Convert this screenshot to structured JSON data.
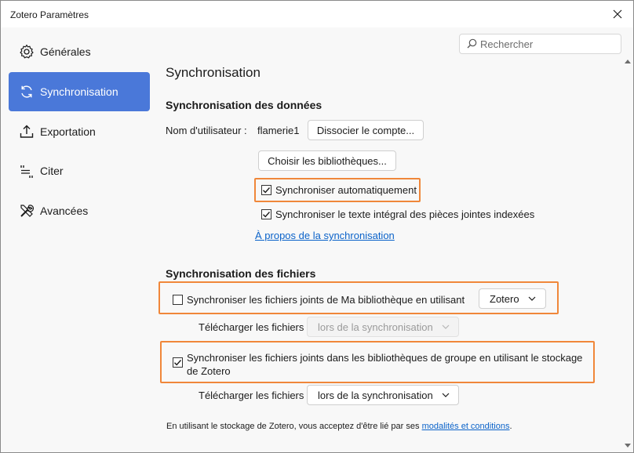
{
  "window": {
    "title": "Zotero Paramètres"
  },
  "search": {
    "placeholder": "Rechercher",
    "value": ""
  },
  "sidebar": {
    "items": [
      {
        "label": "Générales",
        "icon": "gear-icon",
        "active": false
      },
      {
        "label": "Synchronisation",
        "icon": "sync-icon",
        "active": true
      },
      {
        "label": "Exportation",
        "icon": "export-icon",
        "active": false
      },
      {
        "label": "Citer",
        "icon": "cite-icon",
        "active": false
      },
      {
        "label": "Avancées",
        "icon": "tools-icon",
        "active": false
      }
    ]
  },
  "main": {
    "title": "Synchronisation",
    "data_sync": {
      "heading": "Synchronisation des données",
      "username_label": "Nom d'utilisateur :",
      "username_value": "flamerie1",
      "unlink_button": "Dissocier le compte...",
      "choose_libraries_button": "Choisir les bibliothèques...",
      "auto_sync": {
        "label": "Synchroniser automatiquement",
        "checked": true
      },
      "fulltext_sync": {
        "label": "Synchroniser le texte intégral des pièces jointes indexées",
        "checked": true
      },
      "about_link": "À propos de la synchronisation"
    },
    "file_sync": {
      "heading": "Synchronisation des fichiers",
      "my_library": {
        "label": "Synchroniser les fichiers joints de Ma bibliothèque en utilisant",
        "checked": false,
        "service": "Zotero",
        "download_label": "Télécharger les fichiers",
        "download_value": "lors de la synchronisation",
        "download_enabled": false
      },
      "group_libraries": {
        "label_line1": "Synchroniser les fichiers joints dans les bibliothèques de groupe en utilisant le stockage",
        "label_line2": "de Zotero",
        "checked": true,
        "download_label": "Télécharger les fichiers",
        "download_value": "lors de la synchronisation",
        "download_enabled": true
      },
      "terms_prefix": "En utilisant le stockage de Zotero, vous acceptez d'être lié par ses",
      "terms_link": "modalités et conditions",
      "terms_suffix": "."
    }
  },
  "colors": {
    "accent": "#4a78d9",
    "highlight": "#f0873a",
    "link": "#0a62c9"
  }
}
